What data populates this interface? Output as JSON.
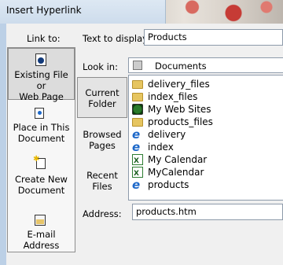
{
  "window": {
    "title": "Insert Hyperlink"
  },
  "link_to": {
    "label": "Link to:",
    "items": [
      {
        "line1": "Existing File or",
        "line2": "Web Page",
        "icon": "web-page-file-icon",
        "active": true
      },
      {
        "line1": "Place in This",
        "line2": "Document",
        "icon": "place-in-document-icon",
        "active": false
      },
      {
        "line1": "Create New",
        "line2": "Document",
        "icon": "create-new-document-icon",
        "active": false
      },
      {
        "line1": "E-mail Address",
        "line2": "",
        "icon": "email-address-icon",
        "active": false
      }
    ]
  },
  "text_to_display": {
    "label": "Text to display:",
    "value": "Products"
  },
  "look_in": {
    "label": "Look in:",
    "value": "Documents",
    "icon": "folder-icon"
  },
  "places": [
    {
      "line1": "Current",
      "line2": "Folder",
      "active": true
    },
    {
      "line1": "Browsed",
      "line2": "Pages",
      "active": false
    },
    {
      "line1": "Recent",
      "line2": "Files",
      "active": false
    }
  ],
  "files": [
    {
      "name": "delivery_files",
      "icon": "folder-icon"
    },
    {
      "name": "index_files",
      "icon": "folder-icon"
    },
    {
      "name": "My Web Sites",
      "icon": "web-sites-folder-icon"
    },
    {
      "name": "products_files",
      "icon": "folder-icon"
    },
    {
      "name": "delivery",
      "icon": "ie-page-icon"
    },
    {
      "name": "index",
      "icon": "ie-page-icon"
    },
    {
      "name": "My Calendar",
      "icon": "excel-file-icon"
    },
    {
      "name": "MyCalendar",
      "icon": "excel-file-icon"
    },
    {
      "name": "products",
      "icon": "ie-page-icon"
    }
  ],
  "address": {
    "label": "Address:",
    "value": "products.htm"
  }
}
